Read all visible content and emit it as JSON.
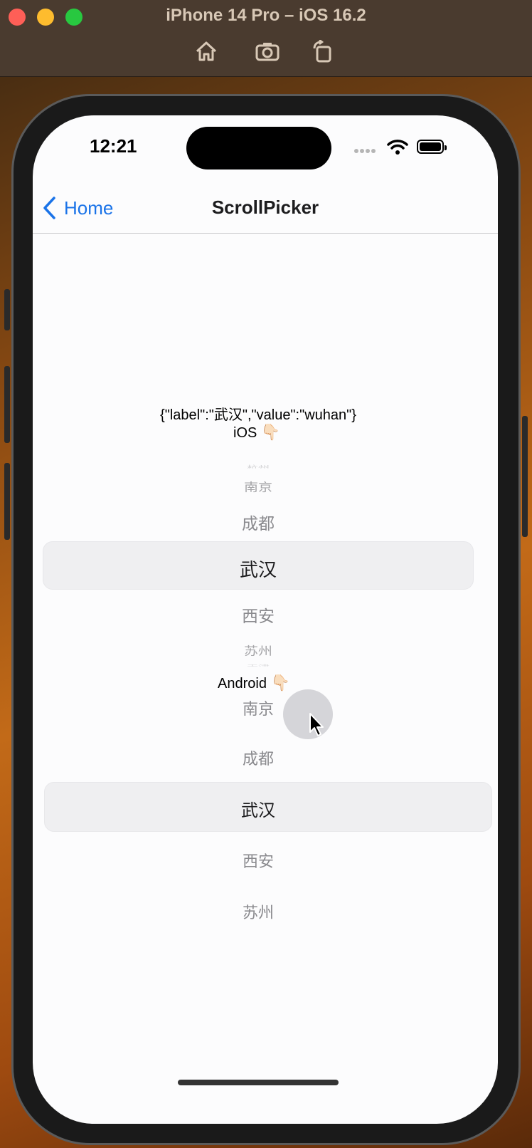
{
  "window": {
    "title": "iPhone 14 Pro – iOS 16.2",
    "toolbar_icons": [
      "home-icon",
      "screenshot-icon",
      "rotate-icon"
    ]
  },
  "status_bar": {
    "time": "12:21"
  },
  "navbar": {
    "back_label": "Home",
    "title": "ScrollPicker"
  },
  "output_json": "{\"label\":\"武汉\",\"value\":\"wuhan\"}",
  "ios_picker": {
    "label": "iOS",
    "pointer": "👇🏻",
    "items": [
      "杭州",
      "南京",
      "成都",
      "武汉",
      "西安",
      "苏州",
      "天津"
    ],
    "selected": "武汉"
  },
  "android_picker": {
    "label": "Android",
    "pointer": "👇🏻",
    "items": [
      "南京",
      "成都",
      "武汉",
      "西安",
      "苏州"
    ],
    "selected": "武汉"
  },
  "colors": {
    "accent": "#1a73e8",
    "selection_band": "#efeff1",
    "muted_text": "#8a8a8e"
  }
}
